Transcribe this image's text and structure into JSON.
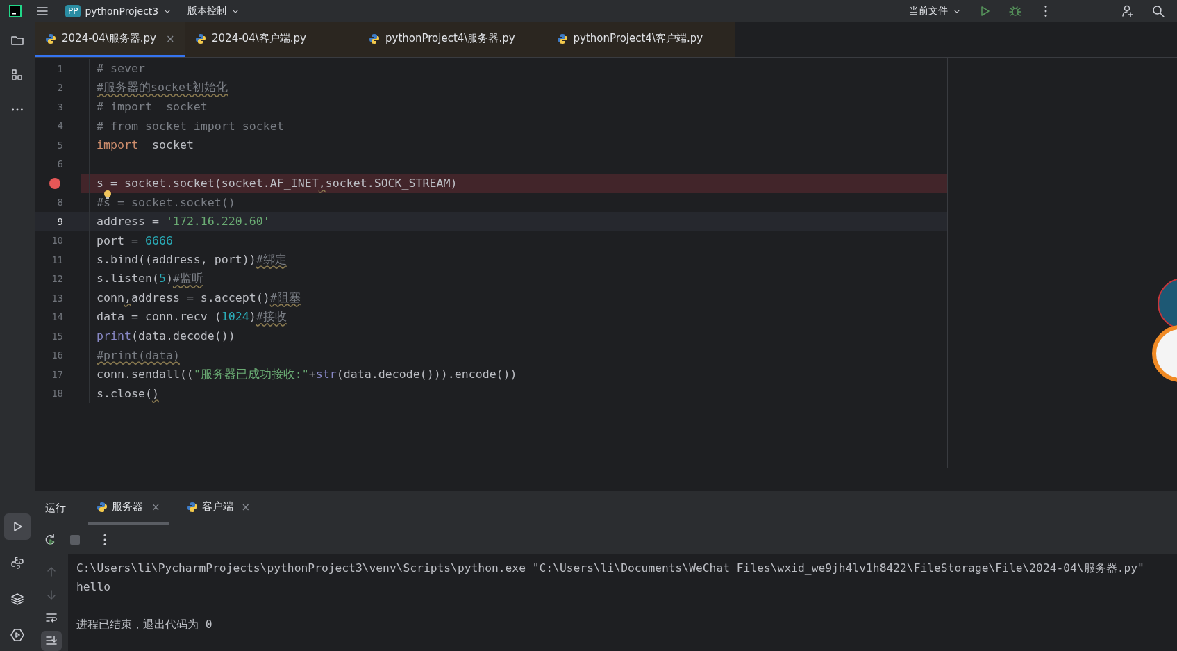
{
  "toolbar": {
    "project_badge": "PP",
    "project": "pythonProject3",
    "vcs": "版本控制",
    "run_config": "当前文件"
  },
  "sidebar_top": [
    {
      "kind": "folder"
    },
    {
      "kind": "structure"
    },
    {
      "kind": "more"
    }
  ],
  "sidebar_bottom": [
    {
      "kind": "run",
      "selected": true
    },
    {
      "kind": "python"
    },
    {
      "kind": "layers"
    },
    {
      "kind": "services"
    }
  ],
  "editor_tabs": [
    {
      "label": "2024-04\\服务器.py",
      "selected": true,
      "close": "×"
    },
    {
      "label": "2024-04\\客户端.py",
      "selected": false
    },
    {
      "label": "pythonProject4\\服务器.py",
      "selected": false
    },
    {
      "label": "pythonProject4\\客户端.py",
      "selected": false
    }
  ],
  "code_lines": [
    {
      "number": "1",
      "segments": [
        {
          "text": "# sever",
          "kind": "comment"
        }
      ]
    },
    {
      "number": "2",
      "segments": [
        {
          "text": "#服务器的socket初始化",
          "kind": "comment",
          "warning": true
        }
      ]
    },
    {
      "number": "3",
      "segments": [
        {
          "text": "# import  socket",
          "kind": "comment"
        }
      ]
    },
    {
      "number": "4",
      "segments": [
        {
          "text": "# from socket import socket",
          "kind": "comment"
        }
      ]
    },
    {
      "number": "5",
      "segments": [
        {
          "text": "import",
          "kind": "keyword"
        },
        {
          "text": "  socket",
          "kind": "plain"
        }
      ]
    },
    {
      "number": "6"
    },
    {
      "breakpoint": true,
      "segments": [
        {
          "text": "s = socket.socket(socket.AF_INET",
          "kind": "plain"
        },
        {
          "text": ",",
          "kind": "plain",
          "warning": true
        },
        {
          "text": "socket.SOCK_STREAM)",
          "kind": "plain"
        }
      ]
    },
    {
      "number": "8",
      "intention": true,
      "segments": [
        {
          "text": "#s = socket.socket()",
          "kind": "comment"
        }
      ]
    },
    {
      "number": "9",
      "current": true,
      "segments": [
        {
          "text": "address = ",
          "kind": "plain"
        },
        {
          "text": "'172.16.220.60'",
          "kind": "string"
        }
      ]
    },
    {
      "number": "10",
      "segments": [
        {
          "text": "port = ",
          "kind": "plain"
        },
        {
          "text": "6666",
          "kind": "number"
        }
      ]
    },
    {
      "number": "11",
      "segments": [
        {
          "text": "s.bind((address, port))",
          "kind": "plain"
        },
        {
          "text": "#绑定",
          "kind": "comment",
          "warning": true
        }
      ]
    },
    {
      "number": "12",
      "segments": [
        {
          "text": "s.listen(",
          "kind": "plain"
        },
        {
          "text": "5",
          "kind": "number"
        },
        {
          "text": ")",
          "kind": "plain"
        },
        {
          "text": "#监听",
          "kind": "comment",
          "warning": true
        }
      ]
    },
    {
      "number": "13",
      "segments": [
        {
          "text": "conn",
          "kind": "plain"
        },
        {
          "text": ",",
          "kind": "plain",
          "warning": true
        },
        {
          "text": "address = s.accept()",
          "kind": "plain"
        },
        {
          "text": "#阻塞",
          "kind": "comment",
          "warning": true
        }
      ]
    },
    {
      "number": "14",
      "segments": [
        {
          "text": "data = conn.recv (",
          "kind": "plain"
        },
        {
          "text": "1024",
          "kind": "number"
        },
        {
          "text": ")",
          "kind": "plain"
        },
        {
          "text": "#接收",
          "kind": "comment",
          "warning": true
        }
      ]
    },
    {
      "number": "15",
      "segments": [
        {
          "text": "print",
          "kind": "builtin"
        },
        {
          "text": "(data.decode())",
          "kind": "plain"
        }
      ]
    },
    {
      "number": "16",
      "segments": [
        {
          "text": "#print(data)",
          "kind": "comment",
          "warning": true
        }
      ]
    },
    {
      "number": "17",
      "segments": [
        {
          "text": "conn.sendall((",
          "kind": "plain"
        },
        {
          "text": "\"服务器已成功接收:\"",
          "kind": "string"
        },
        {
          "text": "+",
          "kind": "plain"
        },
        {
          "text": "str",
          "kind": "builtin"
        },
        {
          "text": "(data.decode())).encode())",
          "kind": "plain"
        }
      ]
    },
    {
      "number": "18",
      "segments": [
        {
          "text": "s.close(",
          "kind": "plain"
        },
        {
          "text": ")",
          "kind": "plain",
          "warning": true
        }
      ]
    }
  ],
  "run_panel": {
    "title": "运行",
    "tabs": [
      {
        "label": "服务器",
        "selected": true,
        "close": "×"
      },
      {
        "label": "客户端",
        "selected": false,
        "close": "×"
      }
    ],
    "gutter": [
      {
        "kind": "up"
      },
      {
        "kind": "down"
      },
      {
        "kind": "wrap"
      },
      {
        "kind": "scroll_end",
        "selected": true
      }
    ],
    "output_blocks": [
      {
        "lines": [
          "C:\\Users\\li\\PycharmProjects\\pythonProject3\\venv\\Scripts\\python.exe \"C:\\Users\\li\\Documents\\WeChat Files\\wxid_we9jh4lv1h8422\\FileStorage\\File\\2024-04\\服务器.py\"",
          "hello"
        ]
      },
      {
        "lines": [
          "进程已结束，退出代码为 0"
        ]
      }
    ]
  }
}
